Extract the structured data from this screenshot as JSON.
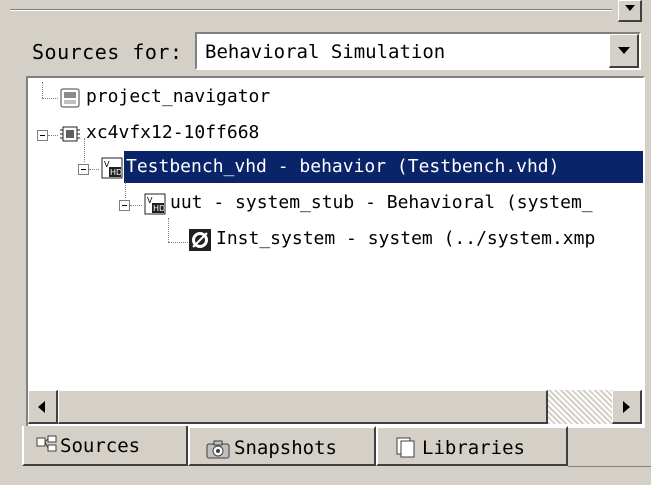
{
  "sources_for": {
    "label": "Sources for:",
    "selected": "Behavioral Simulation"
  },
  "tree": {
    "nodes": [
      {
        "label": "project_navigator",
        "icon": "project-icon"
      },
      {
        "label": "xc4vfx12-10ff668",
        "icon": "chip-icon"
      },
      {
        "label": "Testbench_vhd - behavior (Testbench.vhd)",
        "icon": "vhdl-file-icon",
        "selected": true
      },
      {
        "label": "uut - system_stub - Behavioral (system_",
        "icon": "vhdl-file-icon"
      },
      {
        "label": "Inst_system - system (../system.xmp",
        "icon": "xmp-file-icon"
      }
    ]
  },
  "tabs": [
    {
      "label": "Sources",
      "icon": "sources-icon",
      "active": true
    },
    {
      "label": "Snapshots",
      "icon": "snapshots-icon",
      "active": false
    },
    {
      "label": "Libraries",
      "icon": "libraries-icon",
      "active": false
    }
  ],
  "colors": {
    "panel_bg": "#d4d0c8",
    "selection_bg": "#0a246a",
    "selection_text": "#ffffff"
  }
}
